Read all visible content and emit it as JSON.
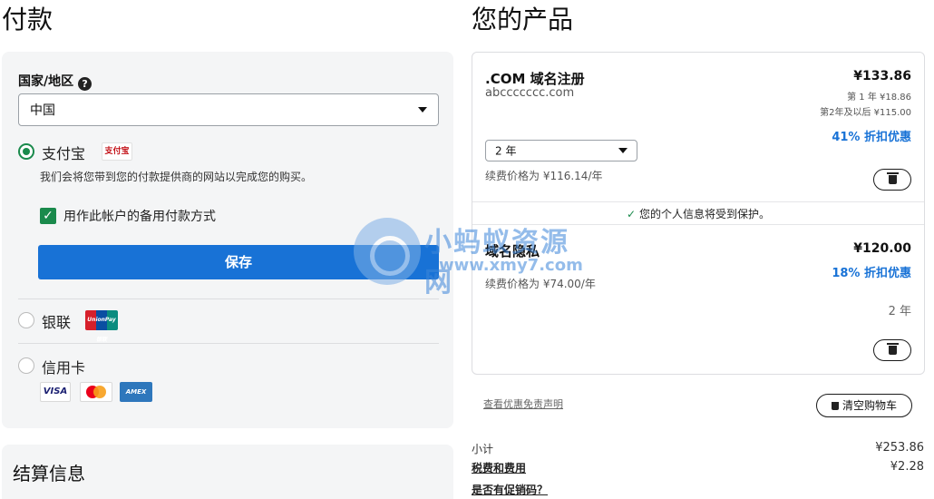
{
  "payment": {
    "title": "付款",
    "country_label": "国家/地区",
    "country_value": "中国",
    "alipay": {
      "label": "支付宝",
      "logo_text": "支付宝",
      "desc": "我们会将您带到您的付款提供商的网站以完成您的购买。",
      "backup_label": "用作此帐户的备用付款方式",
      "save_label": "保存",
      "selected": true,
      "backup_checked": true
    },
    "unionpay": {
      "label": "银联",
      "logo_text": "UnionPay 银联"
    },
    "creditcard": {
      "label": "信用卡",
      "cards": [
        "VISA",
        "MC",
        "AMEX"
      ]
    }
  },
  "billing": {
    "title": "结算信息"
  },
  "products": {
    "title": "您的产品",
    "items": [
      {
        "name": ".COM 域名注册",
        "domain": "abccccccc.com",
        "price": "¥133.86",
        "note1": "第 1 年 ¥18.86",
        "note2": "第2年及以后 ¥115.00",
        "discount": "41% 折扣优惠",
        "term": "2 年",
        "renewal": "续费价格为 ¥116.14/年"
      },
      {
        "name": "域名隐私",
        "price": "¥120.00",
        "discount": "18% 折扣优惠",
        "renewal": "续费价格为 ¥74.00/年",
        "term": "2 年"
      }
    ],
    "privacy_text": "您的个人信息将受到保护。",
    "disclaimer_link": "查看优惠免责声明",
    "clear_cart": "清空购物车"
  },
  "summary": {
    "subtotal_label": "小计",
    "subtotal_value": "¥253.86",
    "tax_label": "税费和费用",
    "tax_value": "¥2.28",
    "promo_label": "是否有促销码？"
  },
  "watermark": {
    "line1": "小蚂蚁资源网",
    "line2": "www.xmy7.com"
  },
  "colors": {
    "accent": "#1872d6",
    "success": "#1a8a4c",
    "panel_bg": "#f4f5f6"
  }
}
